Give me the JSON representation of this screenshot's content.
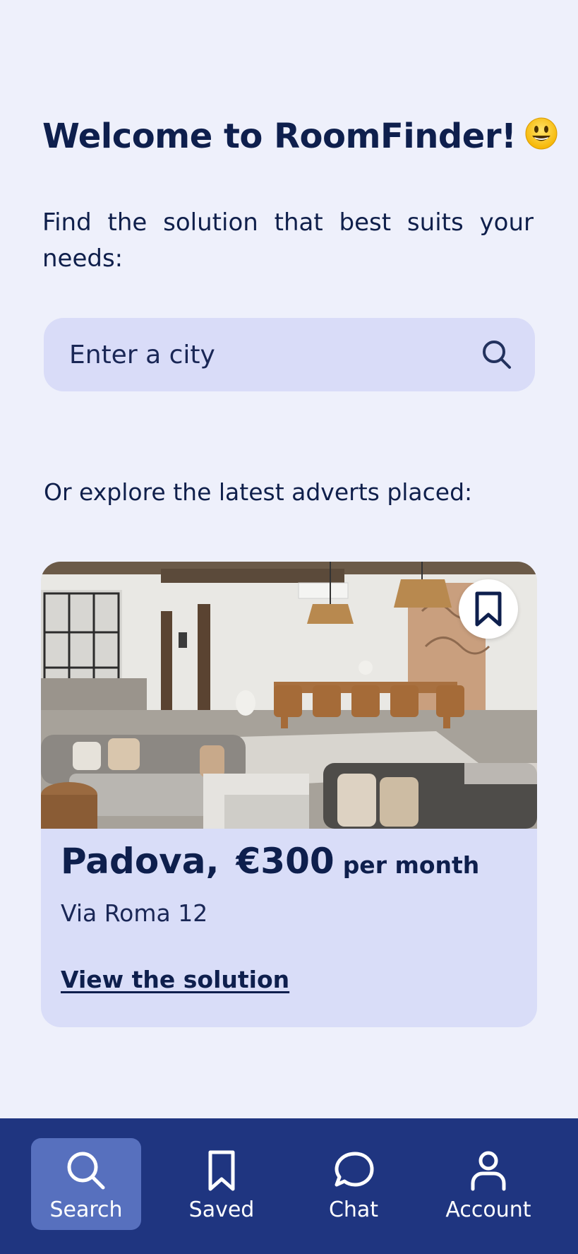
{
  "header": {
    "title": "Welcome to RoomFinder!",
    "emoji_icon": "smiley-face-icon",
    "subtitle": "Find the solution that best suits your needs:"
  },
  "search": {
    "placeholder": "Enter a city",
    "icon": "search-icon"
  },
  "explore_label": "Or explore the latest adverts placed:",
  "listing": {
    "city": "Padova,",
    "price": "€300",
    "period": "per month",
    "address": "Via Roma 12",
    "link_label": "View the solution",
    "bookmark_icon": "bookmark-icon",
    "image": "living-room-photo"
  },
  "nav": {
    "items": [
      {
        "label": "Search",
        "icon": "search-icon",
        "active": true
      },
      {
        "label": "Saved",
        "icon": "bookmark-icon",
        "active": false
      },
      {
        "label": "Chat",
        "icon": "chat-bubble-icon",
        "active": false
      },
      {
        "label": "Account",
        "icon": "person-icon",
        "active": false
      }
    ]
  },
  "colors": {
    "background": "#eef0fb",
    "text_primary": "#0e1f4d",
    "search_bg": "#d9dcf8",
    "card_bg": "#d9ddf8",
    "nav_bg": "#1f3580",
    "nav_active": "#5770be"
  }
}
